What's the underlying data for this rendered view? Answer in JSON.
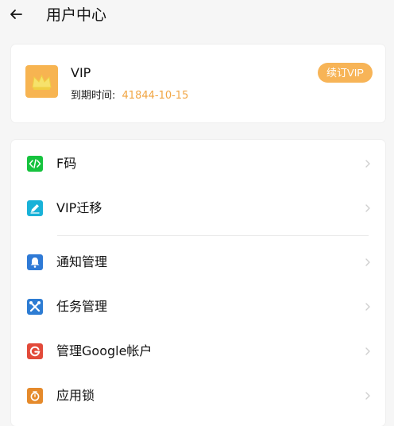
{
  "header": {
    "title": "用户中心"
  },
  "vip": {
    "title": "VIP",
    "expire_label": "到期时间:",
    "expire_value": "41844-10-15",
    "renew_label": "续订VIP"
  },
  "menu": {
    "items": [
      {
        "label": "F码",
        "icon": "code-icon",
        "color": "#16c33e"
      },
      {
        "label": "VIP迁移",
        "icon": "edit-icon",
        "color": "#19b2d8"
      },
      {
        "label": "通知管理",
        "icon": "bell-icon",
        "color": "#2f7ad6"
      },
      {
        "label": "任务管理",
        "icon": "tools-icon",
        "color": "#2d7cd3"
      },
      {
        "label": "管理Google帐户",
        "icon": "google-icon",
        "color": "#e24a3a"
      },
      {
        "label": "应用锁",
        "icon": "lock-icon",
        "color": "#e58a2b"
      }
    ]
  },
  "colors": {
    "accent": "#f7b457",
    "background": "#f6f6f6"
  }
}
